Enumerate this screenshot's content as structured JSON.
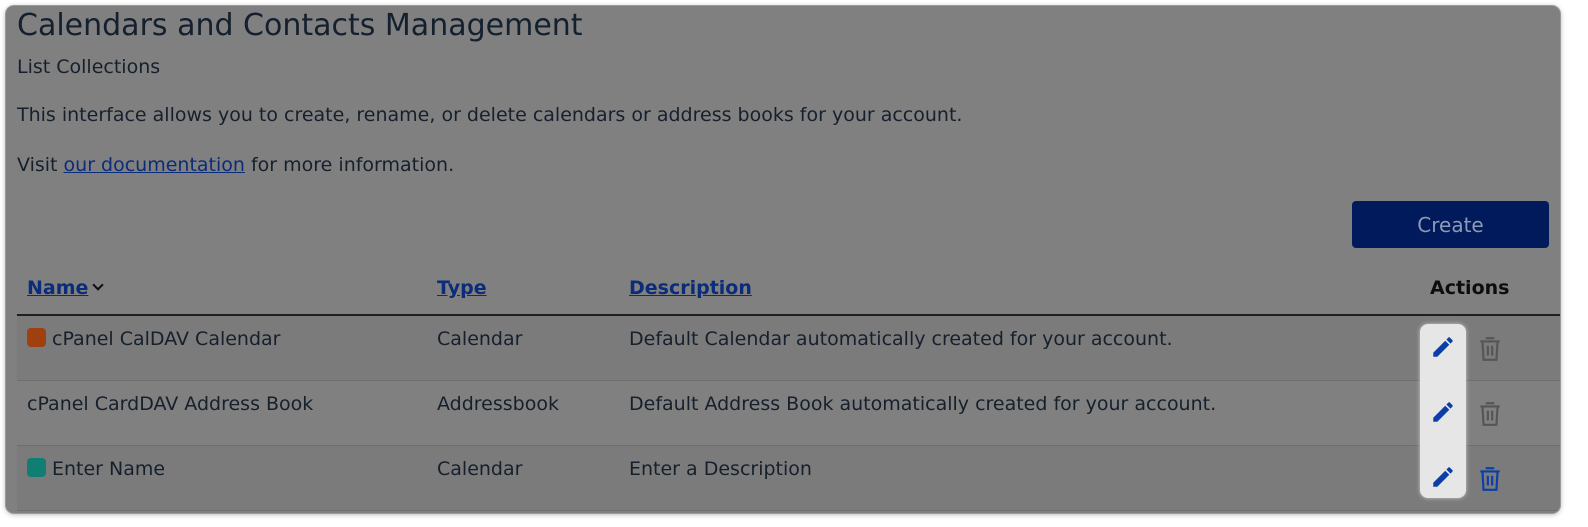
{
  "page": {
    "title": "Calendars and Contacts Management",
    "subtitle": "List Collections",
    "description": "This interface allows you to create, rename, or delete calendars or address books for your account.",
    "doc_prefix": "Visit ",
    "doc_link": "our documentation",
    "doc_suffix": " for more information."
  },
  "toolbar": {
    "create_label": "Create"
  },
  "table": {
    "headers": {
      "name": "Name",
      "type": "Type",
      "description": "Description",
      "actions": "Actions"
    },
    "rows": [
      {
        "name": "cPanel CalDAV Calendar",
        "type": "Calendar",
        "description": "Default Calendar automatically created for your account.",
        "color": "#a1400f"
      },
      {
        "name": "cPanel CardDAV Address Book",
        "type": "Addressbook",
        "description": "Default Address Book automatically created for your account.",
        "color": ""
      },
      {
        "name": "Enter Name",
        "type": "Calendar",
        "description": "Enter a Description",
        "color": "#0f7e73"
      }
    ]
  },
  "icons": {
    "edit": "pencil-icon",
    "delete": "trash-icon",
    "sort": "chevron-down-icon"
  },
  "colors": {
    "link": "#0b2c7a",
    "primary_button": "#001a5c",
    "edit_icon": "#0b3ea8",
    "delete_icon_active": "#0b3ea8",
    "delete_icon_disabled": "#555555"
  }
}
